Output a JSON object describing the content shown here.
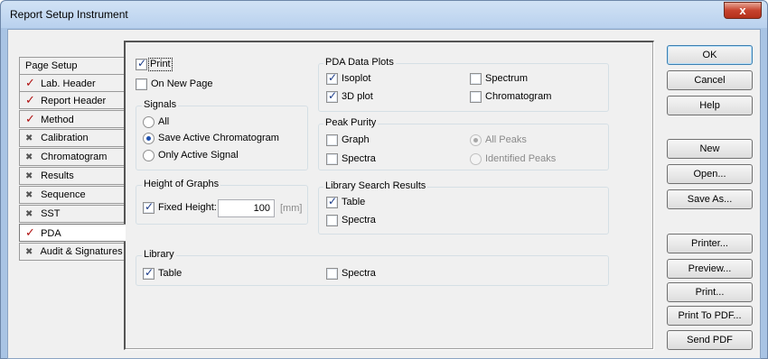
{
  "window": {
    "title": "Report Setup Instrument",
    "close_glyph": "x"
  },
  "tabs": [
    {
      "label": "Page Setup",
      "mark": ""
    },
    {
      "label": "Lab. Header",
      "mark": "✓"
    },
    {
      "label": "Report Header",
      "mark": "✓"
    },
    {
      "label": "Method",
      "mark": "✓"
    },
    {
      "label": "Calibration",
      "mark": "✖"
    },
    {
      "label": "Chromatogram",
      "mark": "✖"
    },
    {
      "label": "Results",
      "mark": "✖"
    },
    {
      "label": "Sequence",
      "mark": "✖"
    },
    {
      "label": "SST",
      "mark": "✖"
    },
    {
      "label": "PDA",
      "mark": "✓",
      "active": true
    },
    {
      "label": "Audit & Signatures",
      "mark": "✖"
    }
  ],
  "pda": {
    "print": {
      "label": "Print",
      "checked": true
    },
    "on_new_page": {
      "label": "On New Page",
      "checked": false
    },
    "signals": {
      "title": "Signals",
      "options": [
        "All",
        "Save Active Chromatogram",
        "Only Active Signal"
      ],
      "selected": "Save Active Chromatogram"
    },
    "height": {
      "title": "Height of Graphs",
      "fixed_label": "Fixed Height:",
      "fixed_checked": true,
      "value": "100",
      "unit": "[mm]"
    },
    "data_plots": {
      "title": "PDA Data Plots",
      "isoplot": {
        "label": "Isoplot",
        "checked": true
      },
      "plot3d": {
        "label": "3D plot",
        "checked": true
      },
      "spectrum": {
        "label": "Spectrum",
        "checked": false
      },
      "chromatogram": {
        "label": "Chromatogram",
        "checked": false
      }
    },
    "peak_purity": {
      "title": "Peak Purity",
      "graph": {
        "label": "Graph",
        "checked": false
      },
      "spectra": {
        "label": "Spectra",
        "checked": false
      },
      "all_peaks": "All Peaks",
      "identified_peaks": "Identified Peaks"
    },
    "library_search": {
      "title": "Library Search Results",
      "table": {
        "label": "Table",
        "checked": true
      },
      "spectra": {
        "label": "Spectra",
        "checked": false
      }
    },
    "library": {
      "title": "Library",
      "table": {
        "label": "Table",
        "checked": true
      },
      "spectra": {
        "label": "Spectra",
        "checked": false
      }
    }
  },
  "buttons": [
    "OK",
    "Cancel",
    "Help",
    "New",
    "Open...",
    "Save As...",
    "Printer...",
    "Preview...",
    "Print...",
    "Print To PDF...",
    "Send PDF"
  ],
  "colors": {
    "accent": "#3c7fb1",
    "check_mark": "#b01010",
    "close_button": "#c7432e"
  }
}
